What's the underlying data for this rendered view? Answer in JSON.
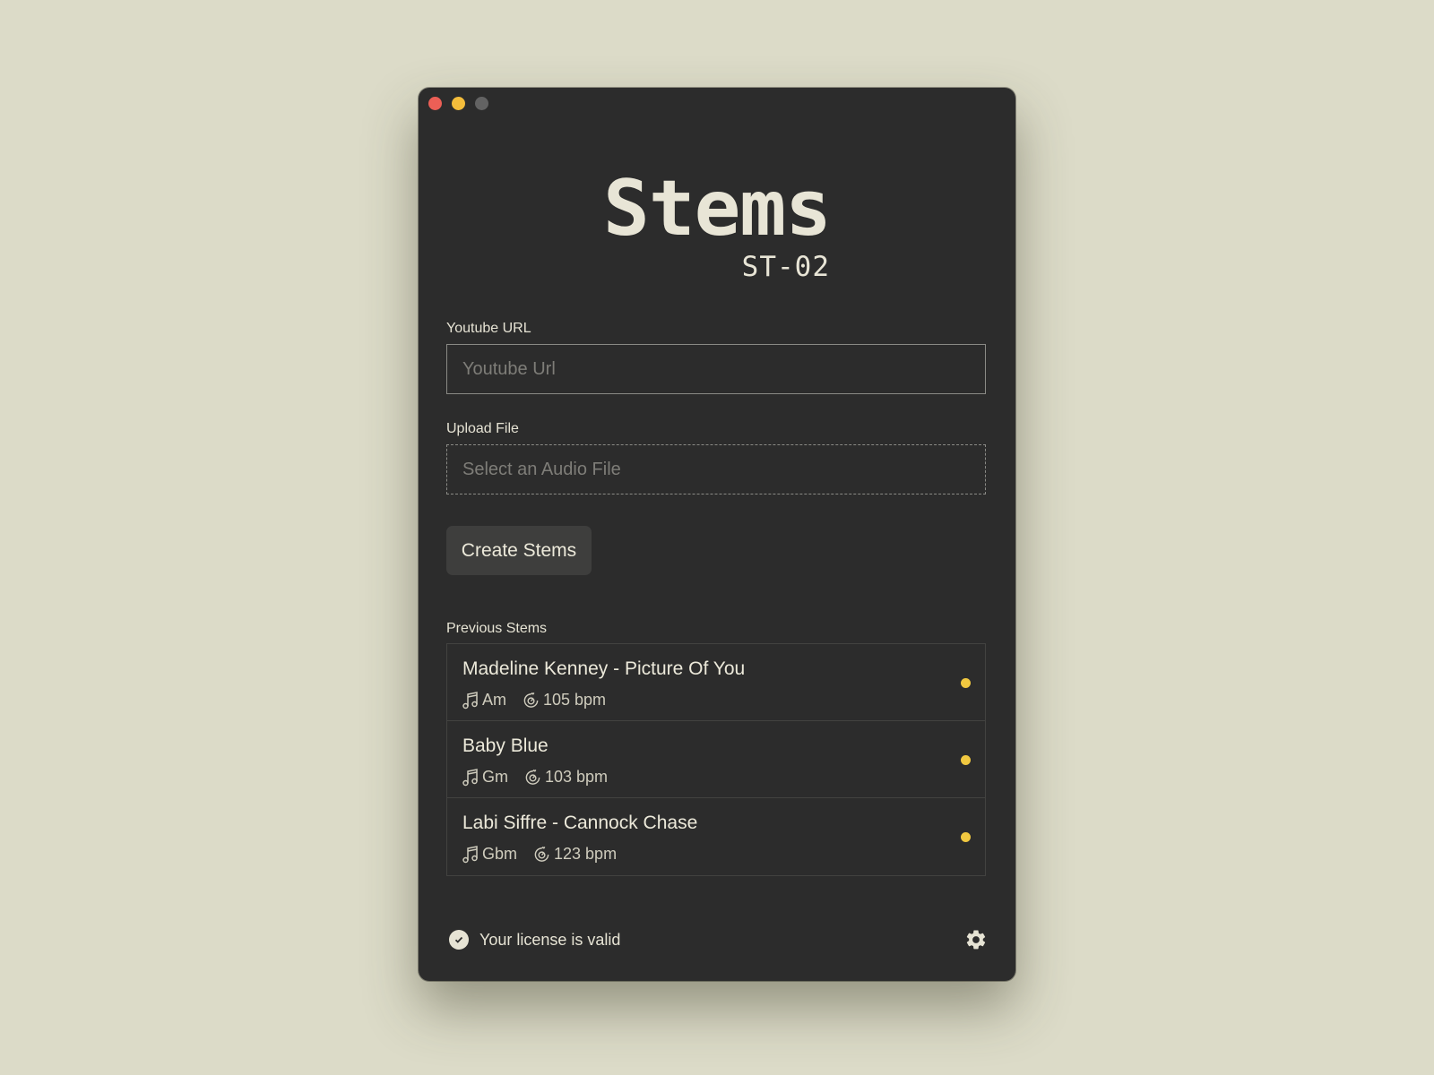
{
  "app": {
    "title": "Stems",
    "model": "ST-02"
  },
  "window_controls": [
    "close",
    "minimize",
    "maximize"
  ],
  "youtube": {
    "label": "Youtube URL",
    "placeholder": "Youtube Url",
    "value": ""
  },
  "upload": {
    "label": "Upload File",
    "placeholder": "Select an Audio File"
  },
  "create_button": "Create Stems",
  "previous": {
    "label": "Previous Stems",
    "items": [
      {
        "title": "Madeline Kenney - Picture Of You",
        "key": "Am",
        "bpm": "105 bpm",
        "status_icon": "status-dot"
      },
      {
        "title": "Baby Blue",
        "key": "Gm",
        "bpm": "103 bpm",
        "status_icon": "status-dot"
      },
      {
        "title": "Labi Siffre - Cannock Chase",
        "key": "Gbm",
        "bpm": "123 bpm",
        "status_icon": "status-dot"
      }
    ]
  },
  "license": {
    "status": "Your license is valid",
    "icon": "check-circle-icon"
  },
  "settings_icon": "gear-icon",
  "colors": {
    "background": "#dcdbc8",
    "window": "#2c2c2c",
    "text": "#e8e5d6",
    "accent_dot": "#f1c840",
    "close": "#ec5f56",
    "minimize": "#f4bd3b",
    "maximize": "#636363"
  }
}
